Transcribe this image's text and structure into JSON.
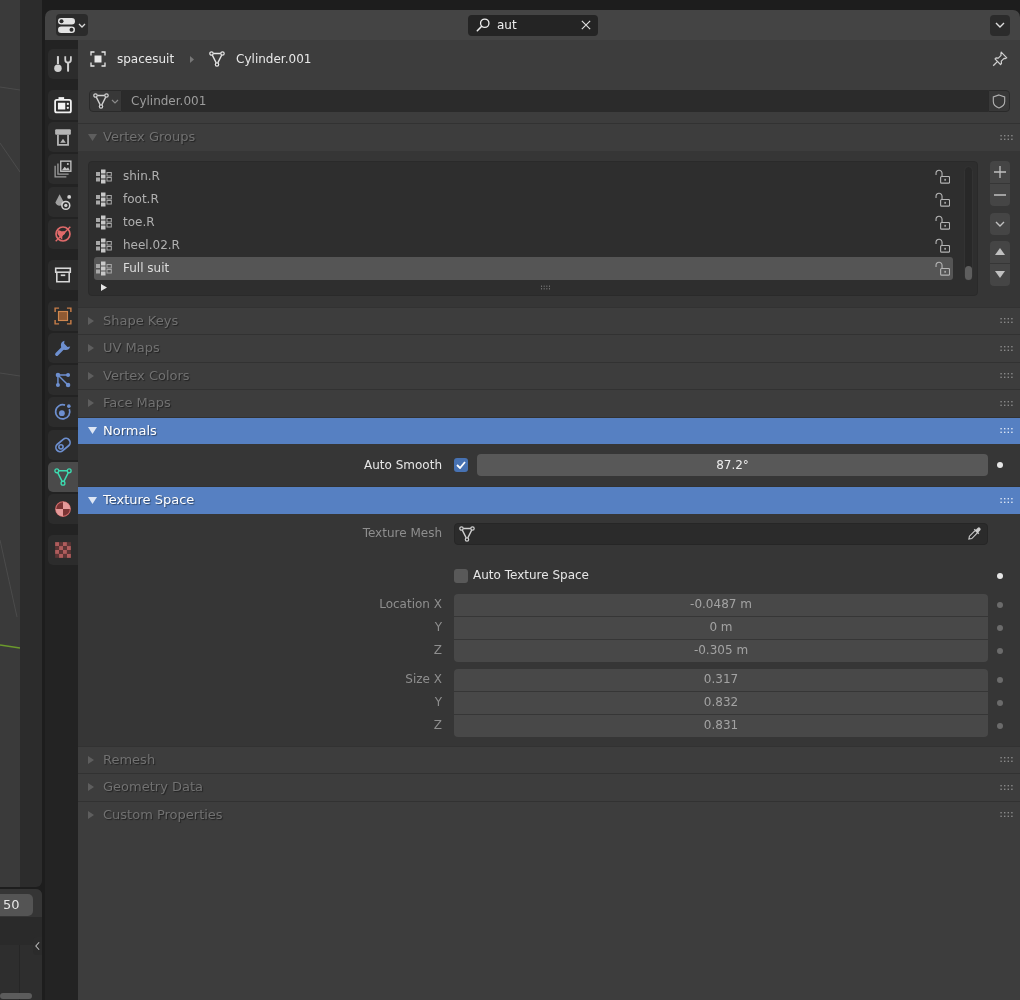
{
  "header": {
    "search": {
      "value": "aut"
    }
  },
  "bottom_left_region": {
    "field_value": "50"
  },
  "sidebar": {
    "tab_groups": [
      [
        {
          "kind": "tool",
          "selected": false
        }
      ],
      [
        {
          "kind": "render",
          "selected": false
        },
        {
          "kind": "output",
          "selected": false
        },
        {
          "kind": "view_layer",
          "selected": false
        },
        {
          "kind": "scene",
          "selected": false
        },
        {
          "kind": "world",
          "selected": false
        }
      ],
      [
        {
          "kind": "collection",
          "selected": false
        }
      ],
      [
        {
          "kind": "object",
          "selected": false
        },
        {
          "kind": "modifiers",
          "selected": false
        },
        {
          "kind": "particles",
          "selected": false
        },
        {
          "kind": "physics",
          "selected": false
        },
        {
          "kind": "constraints",
          "selected": false
        },
        {
          "kind": "data",
          "selected": true
        },
        {
          "kind": "material",
          "selected": false
        }
      ],
      [
        {
          "kind": "texture",
          "selected": false
        }
      ]
    ]
  },
  "breadcrumb": [
    {
      "kind": "object",
      "label": "spacesuit"
    },
    {
      "kind": "mesh",
      "label": "Cylinder.001"
    }
  ],
  "datablock": {
    "name": "Cylinder.001"
  },
  "panels": [
    {
      "title": "Vertex Groups",
      "expanded": true,
      "highlighted": false,
      "items": [
        {
          "name": "shin.R",
          "selected": false
        },
        {
          "name": "foot.R",
          "selected": false
        },
        {
          "name": "toe.R",
          "selected": false
        },
        {
          "name": "heel.02.R",
          "selected": false
        },
        {
          "name": "Full suit",
          "selected": true
        }
      ]
    },
    {
      "title": "Shape Keys",
      "expanded": false,
      "highlighted": false
    },
    {
      "title": "UV Maps",
      "expanded": false,
      "highlighted": false
    },
    {
      "title": "Vertex Colors",
      "expanded": false,
      "highlighted": false
    },
    {
      "title": "Face Maps",
      "expanded": false,
      "highlighted": false
    },
    {
      "title": "Normals",
      "expanded": true,
      "highlighted": true,
      "rows": [
        {
          "kind": "checkbox_value",
          "label": "Auto Smooth",
          "checked": true,
          "value": "87.2°",
          "dimmed": false
        }
      ]
    },
    {
      "title": "Texture Space",
      "expanded": true,
      "highlighted": true,
      "rows": [
        {
          "kind": "object_field",
          "label": "Texture Mesh",
          "dimmed": true
        },
        {
          "kind": "checkbox",
          "label": "Auto Texture Space",
          "checked": false,
          "dimmed": false
        },
        {
          "kind": "vector",
          "dimmed": true,
          "components": [
            {
              "label": "Location X",
              "value": "-0.0487 m"
            },
            {
              "label": "Y",
              "value": "0 m"
            },
            {
              "label": "Z",
              "value": "-0.305 m"
            }
          ]
        },
        {
          "kind": "vector",
          "dimmed": true,
          "components": [
            {
              "label": "Size X",
              "value": "0.317"
            },
            {
              "label": "Y",
              "value": "0.832"
            },
            {
              "label": "Z",
              "value": "0.831"
            }
          ]
        }
      ]
    },
    {
      "title": "Remesh",
      "expanded": false,
      "highlighted": false
    },
    {
      "title": "Geometry Data",
      "expanded": false,
      "highlighted": false
    },
    {
      "title": "Custom Properties",
      "expanded": false,
      "highlighted": false
    }
  ]
}
